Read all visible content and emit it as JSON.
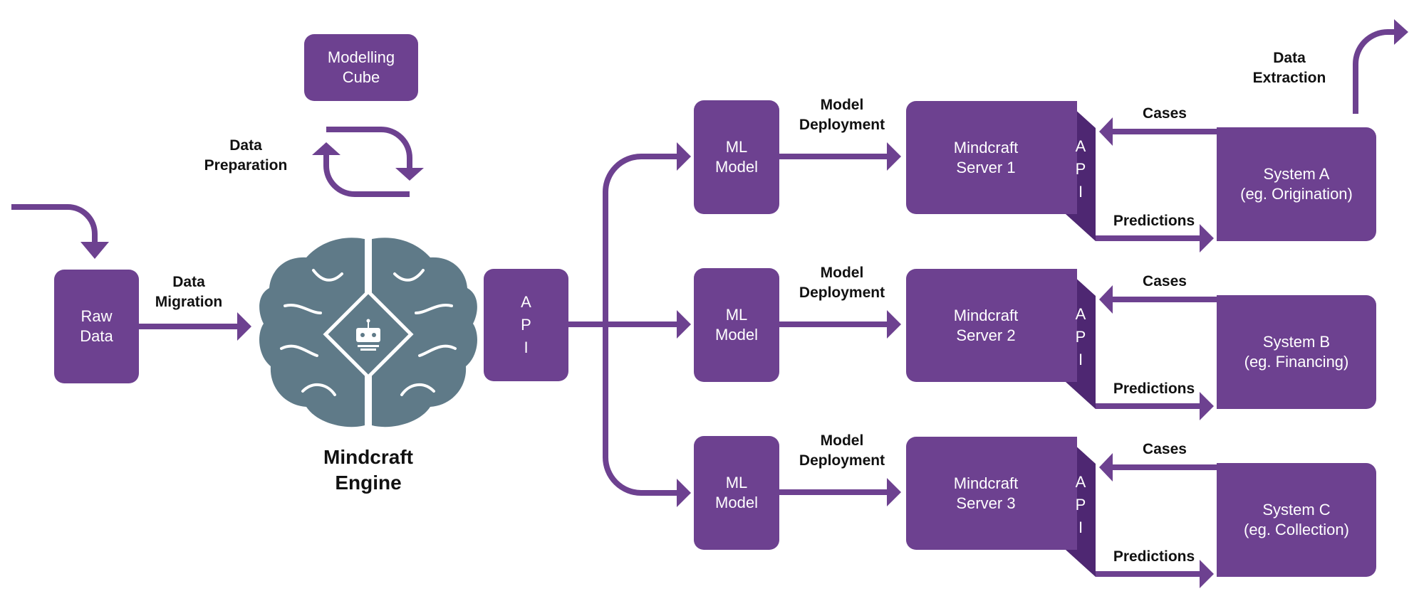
{
  "colors": {
    "primary": "#6d4190",
    "api_panel": "#4e2772",
    "brain": "#5f7a88",
    "text": "#111111"
  },
  "source": {
    "raw_data": "Raw\nData",
    "data_migration": "Data\nMigration"
  },
  "engine": {
    "label": "Mindcraft\nEngine",
    "icon": "brain-robot-icon",
    "data_preparation": "Data\nPreparation",
    "modelling_cube": "Modelling\nCube"
  },
  "engine_api": "A\nP\nI",
  "rows": [
    {
      "ml_model": "ML\nModel",
      "deployment": "Model\nDeployment",
      "server": "Mindcraft\nServer 1",
      "api": "A\nP\nI",
      "cases": "Cases",
      "predictions": "Predictions",
      "system": "System A\n(eg. Origination)"
    },
    {
      "ml_model": "ML\nModel",
      "deployment": "Model\nDeployment",
      "server": "Mindcraft\nServer 2",
      "api": "A\nP\nI",
      "cases": "Cases",
      "predictions": "Predictions",
      "system": "System B\n(eg. Financing)"
    },
    {
      "ml_model": "ML\nModel",
      "deployment": "Model\nDeployment",
      "server": "Mindcraft\nServer 3",
      "api": "A\nP\nI",
      "cases": "Cases",
      "predictions": "Predictions",
      "system": "System C\n(eg. Collection)"
    }
  ],
  "data_extraction": "Data\nExtraction"
}
